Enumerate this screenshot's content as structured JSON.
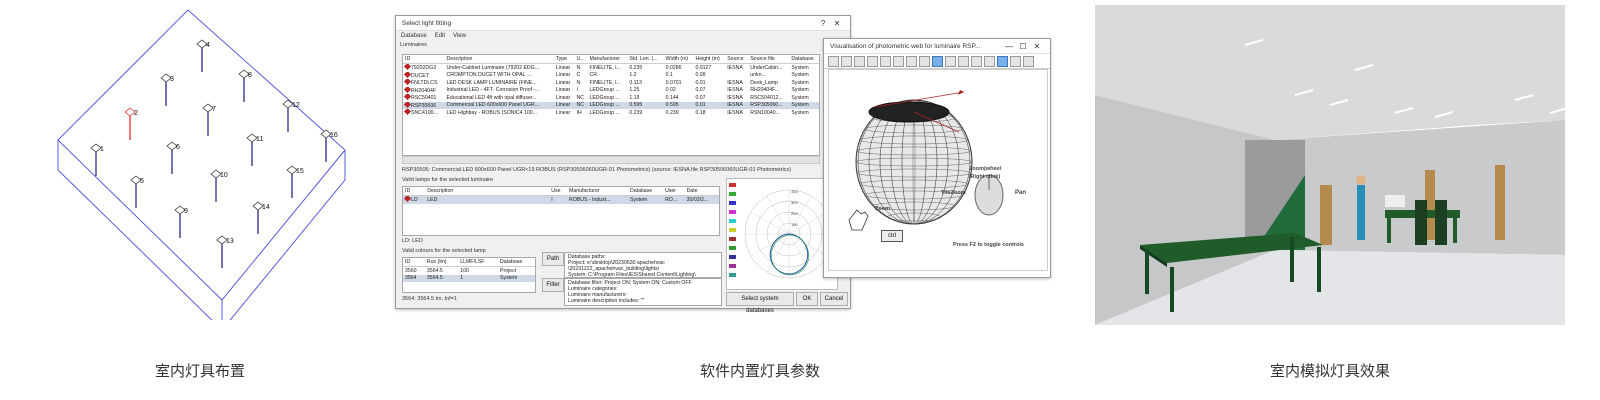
{
  "captions": [
    "室内灯具布置",
    "软件内置灯具参数",
    "室内模拟灯具效果"
  ],
  "layout3d": {
    "fixture_numbers": [
      "1",
      "2",
      "3",
      "4",
      "5",
      "6",
      "7",
      "8",
      "9",
      "10",
      "11",
      "12",
      "13",
      "14",
      "15",
      "16"
    ],
    "colors": {
      "box": "#5a5ae0",
      "fixture": "#2a2a8a",
      "selected": "#e03030"
    }
  },
  "select_window": {
    "title": "Select light fitting",
    "title_controls": [
      "?",
      "✕"
    ],
    "menu": [
      "Database",
      "Edit",
      "View"
    ],
    "luminaires_label": "Luminaires",
    "columns": [
      "ID",
      "Description",
      "Type",
      "U..",
      "Manufacturer",
      "Std. Len. (...",
      "Width (m)",
      "Height (m)",
      "Source",
      "Source file",
      "Database"
    ],
    "rows": [
      [
        "79202DG3",
        "Under-Cabinet Luminaire (79202 EDG...",
        "Linear",
        "N",
        "FINELITE, I...",
        "0.235",
        "0.0286",
        "0.0127",
        "IESNA",
        "UnderCabin...",
        "System"
      ],
      [
        "DUCET",
        "CROMPTON DUCET WITH OPAL ...",
        "Linear",
        "C",
        "CR",
        "1.2",
        "0.1",
        "0.09",
        "",
        "unkn...",
        "System"
      ],
      [
        "FNLTDLCS",
        "LED DESK LAMP LUMINAIRE (FINE...",
        "Linear",
        "N",
        "FINELITE, I...",
        "0.113",
        "0.0701",
        "0.01",
        "IESNA",
        "Desk_Lamp",
        "System"
      ],
      [
        "RH20404F",
        "Industrial LED - 4FT- Corrosion Proof -...",
        "Linear",
        "I",
        "LEDGroup ...",
        "1.25",
        "0.02",
        "0.07",
        "IESNA",
        "RH20404F...",
        "System"
      ],
      [
        "RSC50401",
        "Educational LED 4ft with opal diffuser...",
        "Linear",
        "NC",
        "LEDGroup ...",
        "1.19",
        "0.144",
        "0.07",
        "IESNA",
        "RSC504012...",
        "System"
      ],
      [
        "RSP30506",
        "Commercial LED 600x600 Panel UGR...",
        "Linear",
        "NC",
        "LEDGroup ...",
        "0.595",
        "0.595",
        "0.01",
        "IESNA",
        "RSP305060...",
        "System"
      ],
      [
        "SNC4100...",
        "LED Highbay - ROBUS (SONIC4 100...",
        "Linear",
        "IH",
        "LEDGroup ...",
        "0.239",
        "0.239",
        "0.18",
        "IESNA",
        "RSN10040...",
        "System"
      ]
    ],
    "selected_row": 5,
    "selected_desc": "RSP30506: Commercial LED 600x600 Panel UGR<19 ROBUS (RSP30506060UGR-01 Photometrics) (source: IESNA file RSP30506060UGR-01 Photometrics)",
    "lamps_label": "Valid lamps for the selected luminaire",
    "lamp_columns": [
      "ID",
      "Description",
      "Use",
      "Manufacturer",
      "Database",
      "User",
      "Date"
    ],
    "lamp_rows": [
      [
        "LD",
        "LED",
        "I",
        "ROBUS - Indust...",
        "System",
        "RO...",
        "30/03/2..."
      ]
    ],
    "lamp_status": "LD: LED",
    "colours_label": "Valid colours for the selected lamp",
    "colour_columns": [
      "ID",
      "Rux (lm)",
      "LLMF/LSF",
      "Database"
    ],
    "colour_rows": [
      [
        "3560",
        "3564.5",
        "100",
        "Project"
      ],
      [
        "3564",
        "3564.5",
        "1",
        "System"
      ]
    ],
    "colour_status": "3564: 3564.5 lm, Inf=1",
    "path_button": "Path",
    "filter_button": "Filter",
    "db_paths_label": "Database paths:",
    "db_paths": [
      "Project: e:\\desktop\\20230630 apachehvac",
      "\\20231222_apachehvac_building\\lights\\",
      "System: C:\\Program Files\\IES\\Shared Content\\Lighting\\"
    ],
    "filter_lines": [
      "Database filter: Project ON; System ON; Custom OFF",
      "Luminaire categories:",
      "Luminaire manufacturers:",
      "Luminaire description includes: \"\""
    ],
    "select_system_db": "Select system databases",
    "ok": "OK",
    "cancel": "Cancel",
    "polar_ticks": [
      "400",
      "300",
      "200",
      "100"
    ]
  },
  "web_window": {
    "title": "Visualisation of photometric web for luminaire RSP...",
    "controls": [
      "—",
      "☐",
      "✕"
    ],
    "labels": {
      "zoom_wheel": "Zoom(wheel",
      "right_click": "/Right click)",
      "pan": "Pan",
      "tilt_zoom": "Tilt/Zoom",
      "zoom": "Zoom",
      "ctrl": "ctrl"
    },
    "footer": "Press F2 to toggle controls"
  },
  "render": {
    "colors": {
      "ceiling": "#d9dadc",
      "wall_left": "#c6c7c9",
      "wall_back": "#c9cacb",
      "floor": "#e3e5e8",
      "table": "#1f5c2a",
      "stairs": "#1f6b3a",
      "door": "#b58a4e",
      "person": "#2a8fb8"
    }
  }
}
